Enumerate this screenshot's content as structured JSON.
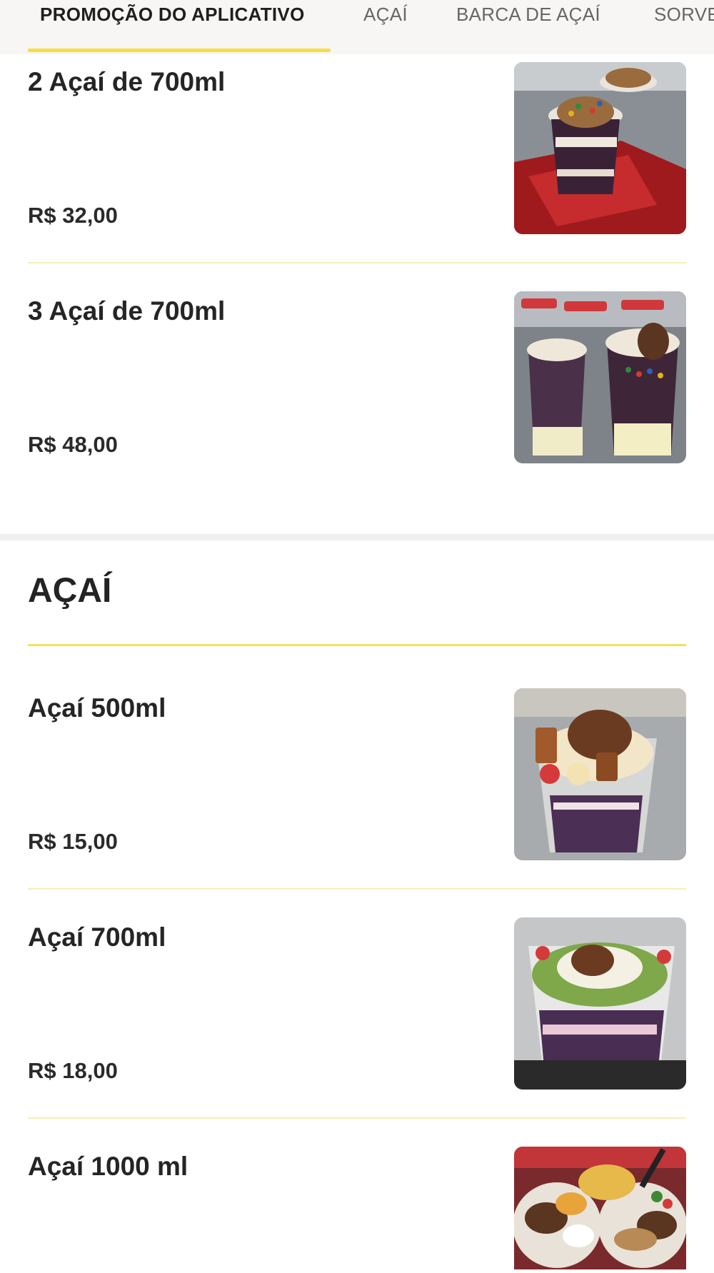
{
  "tabs": [
    {
      "label": "PROMOÇÃO DO APLICATIVO",
      "active": true
    },
    {
      "label": "AÇAÍ",
      "active": false
    },
    {
      "label": "BARCA DE AÇAÍ",
      "active": false
    },
    {
      "label": "SORVETE",
      "active": false
    }
  ],
  "accent_color": "#f7dd43",
  "promo_items": [
    {
      "name": "2 Açaí de 700ml",
      "price": "R$ 32,00",
      "image": "acai-cups-photo"
    },
    {
      "name": "3 Açaí de 700ml",
      "price": "R$ 48,00",
      "image": "acai-cups-photo"
    }
  ],
  "acai_section": {
    "title": "AÇAÍ",
    "items": [
      {
        "name": "Açaí 500ml",
        "price": "R$ 15,00",
        "image": "acai-cup-photo"
      },
      {
        "name": "Açaí 700ml",
        "price": "R$ 18,00",
        "image": "acai-cup-photo"
      },
      {
        "name": "Açaí 1000 ml",
        "price": "",
        "image": "acai-bowls-photo"
      }
    ]
  }
}
